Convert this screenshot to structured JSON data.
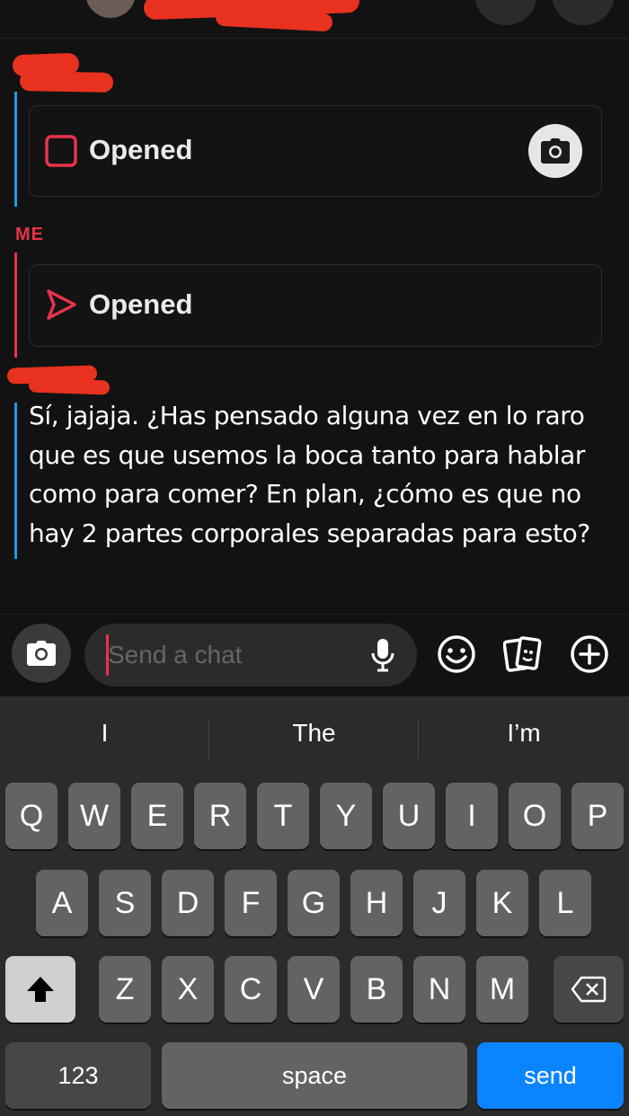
{
  "chat": {
    "me_label": "ME",
    "received_snap_status": "Opened",
    "sent_snap_status": "Opened",
    "message_text": "Sí, jajaja. ¿Has pensado alguna vez en lo raro que es que usemos la boca tanto para hablar como para comer? En plan, ¿cómo es que no hay 2 partes corporales separadas para esto?"
  },
  "colors": {
    "friend_accent": "#1b9ce4",
    "me_accent": "#e8334a",
    "redaction": "#e8321f",
    "send_key": "#0b84ff"
  },
  "chatbar": {
    "placeholder": "Send a chat",
    "icons": [
      "camera-icon",
      "microphone-icon",
      "smiley-icon",
      "stickers-icon",
      "plus-icon"
    ]
  },
  "keyboard": {
    "suggestions": [
      "I",
      "The",
      "I’m"
    ],
    "row1": [
      "Q",
      "W",
      "E",
      "R",
      "T",
      "Y",
      "U",
      "I",
      "O",
      "P"
    ],
    "row2": [
      "A",
      "S",
      "D",
      "F",
      "G",
      "H",
      "J",
      "K",
      "L"
    ],
    "row3": [
      "Z",
      "X",
      "C",
      "V",
      "B",
      "N",
      "M"
    ],
    "numbers_label": "123",
    "space_label": "space",
    "send_label": "send"
  }
}
